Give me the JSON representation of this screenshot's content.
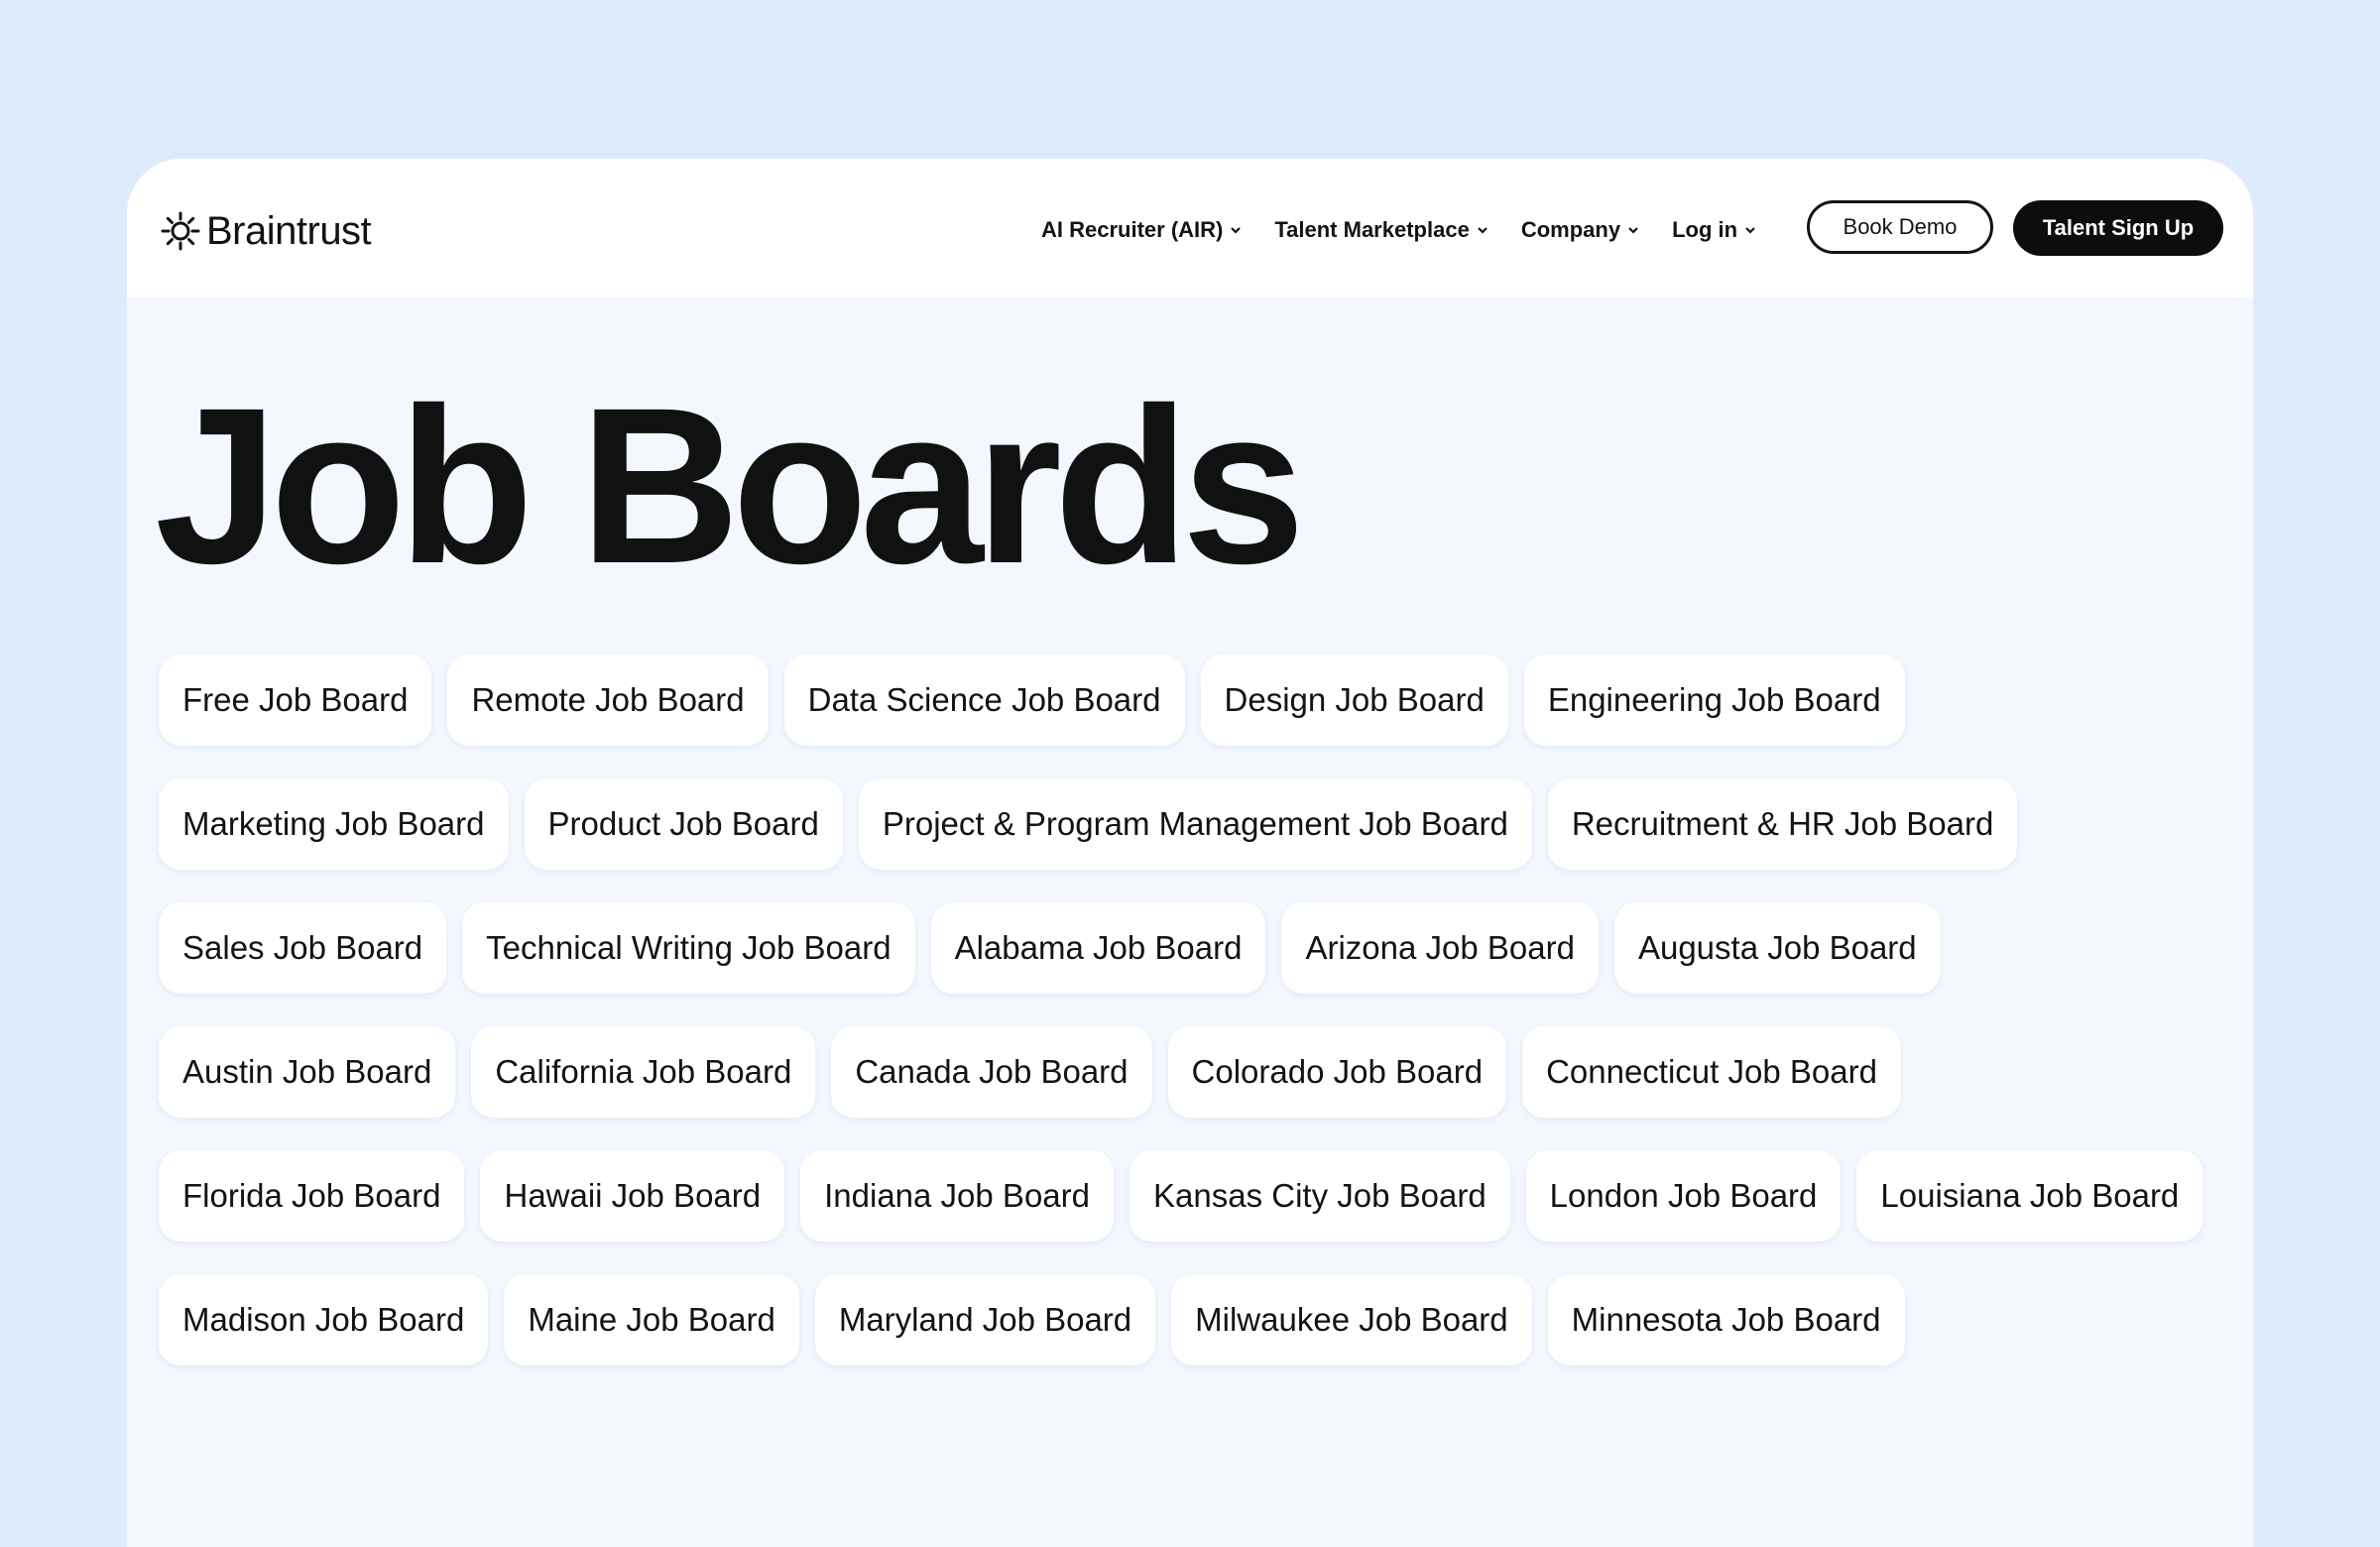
{
  "brand": {
    "name": "Braintrust"
  },
  "nav": {
    "items": [
      {
        "label": "AI Recruiter (AIR)"
      },
      {
        "label": "Talent Marketplace"
      },
      {
        "label": "Company"
      },
      {
        "label": "Log in"
      }
    ],
    "book_demo": "Book Demo",
    "sign_up": "Talent Sign Up"
  },
  "page": {
    "title": "Job Boards"
  },
  "boards": [
    [
      "Free Job Board",
      "Remote Job Board",
      "Data Science Job Board",
      "Design Job Board",
      "Engineering Job Board"
    ],
    [
      "Marketing Job Board",
      "Product Job Board",
      "Project & Program Management Job Board",
      "Recruitment & HR Job Board"
    ],
    [
      "Sales Job Board",
      "Technical Writing Job Board",
      "Alabama Job Board",
      "Arizona Job Board",
      "Augusta Job Board"
    ],
    [
      "Austin Job Board",
      "California Job Board",
      "Canada Job Board",
      "Colorado Job Board",
      "Connecticut Job Board"
    ],
    [
      "Florida Job Board",
      "Hawaii Job Board",
      "Indiana Job Board",
      "Kansas City Job Board",
      "London Job Board",
      "Louisiana Job Board"
    ],
    [
      "Madison Job Board",
      "Maine Job Board",
      "Maryland Job Board",
      "Milwaukee Job Board",
      "Minnesota Job Board"
    ]
  ],
  "icons": {
    "logo": "sun-gear-logo-icon",
    "dropdown": "chevron-down-icon"
  },
  "colors": {
    "page_background": "#dfebfd",
    "card_background": "#f3f7ff",
    "primary": "#0d0d0d"
  }
}
